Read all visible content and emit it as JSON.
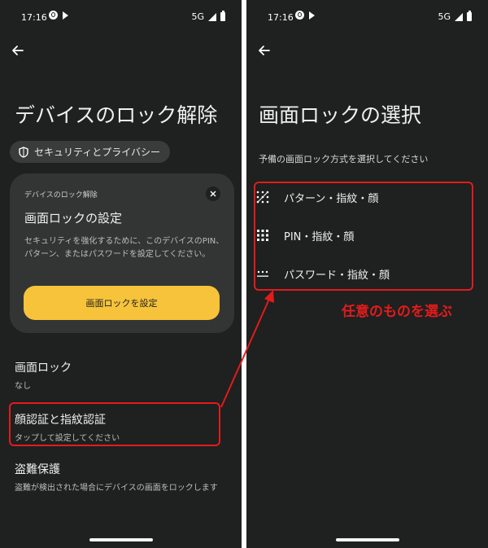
{
  "status_bar": {
    "time": "17:16",
    "network": "5G"
  },
  "left": {
    "title": "デバイスのロック解除",
    "chip_label": "セキュリティとプライバシー",
    "card": {
      "eyebrow": "デバイスのロック解除",
      "title": "画面ロックの設定",
      "description": "セキュリティを強化するために、このデバイスのPIN、パターン、またはパスワードを設定してください。",
      "button_label": "画面ロックを設定"
    },
    "settings": [
      {
        "title": "画面ロック",
        "subtitle": "なし"
      },
      {
        "title": "顔認証と指紋認証",
        "subtitle": "タップして設定してください"
      },
      {
        "title": "盗難保護",
        "subtitle": "盗難が検出された場合にデバイスの画面をロックします"
      }
    ]
  },
  "right": {
    "title": "画面ロックの選択",
    "subtitle": "予備の画面ロック方式を選択してください",
    "options": [
      {
        "label": "パターン・指紋・顔",
        "icon": "pattern-icon"
      },
      {
        "label": "PIN・指紋・顔",
        "icon": "pin-icon"
      },
      {
        "label": "パスワード・指紋・顔",
        "icon": "password-icon"
      }
    ]
  },
  "annotation": {
    "text": "任意のものを選ぶ",
    "color": "#e31b1b"
  },
  "colors": {
    "background": "#1f2020",
    "card": "#333535",
    "accent": "#f6c33a",
    "highlight": "#e31b1b"
  }
}
